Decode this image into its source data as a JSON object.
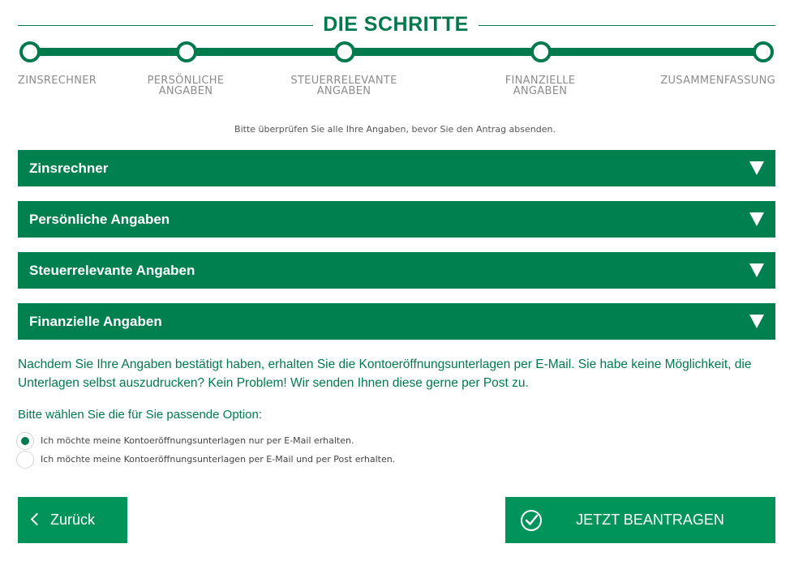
{
  "header": {
    "title": "DIE SCHRITTE"
  },
  "steps": [
    {
      "line1": "ZINSRECHNER",
      "line2": ""
    },
    {
      "line1": "PERSÖNLICHE",
      "line2": "ANGABEN"
    },
    {
      "line1": "STEUERRELEVANTE",
      "line2": "ANGABEN"
    },
    {
      "line1": "FINANZIELLE",
      "line2": "ANGABEN"
    },
    {
      "line1": "ZUSAMMENFASSUNG",
      "line2": ""
    }
  ],
  "instruction": "Bitte überprüfen Sie alle Ihre Angaben, bevor Sie den Antrag absenden.",
  "sections": [
    {
      "label": "Zinsrechner"
    },
    {
      "label": "Persönliche Angaben"
    },
    {
      "label": "Steuerrelevante Angaben"
    },
    {
      "label": "Finanzielle Angaben"
    }
  ],
  "info": {
    "text": "Nachdem Sie Ihre Angaben bestätigt haben, erhalten Sie die Kontoeröffnungsunterlagen per E-Mail. Sie habe keine Möglichkeit, die Unterlagen selbst auszudrucken? Kein Problem! Wir senden Ihnen diese gerne per Post zu."
  },
  "options": {
    "prompt": "Bitte wählen Sie die für Sie passende Option:",
    "items": [
      {
        "label": "Ich möchte meine Kontoeröffnungsunterlagen nur per E-Mail erhalten.",
        "selected": true
      },
      {
        "label": "Ich möchte meine Kontoeröffnungsunterlagen per E-Mail und per Post erhalten.",
        "selected": false
      }
    ]
  },
  "buttons": {
    "back": "Zurück",
    "apply": "JETZT BEANTRAGEN"
  },
  "colors": {
    "primary": "#00804f",
    "button": "#00935a",
    "text_green": "#007a4d",
    "step_label": "#8c8c8c"
  },
  "icons": {
    "accordion": "triangle-down-icon",
    "back": "chevron-left-icon",
    "apply": "check-circle-icon"
  }
}
